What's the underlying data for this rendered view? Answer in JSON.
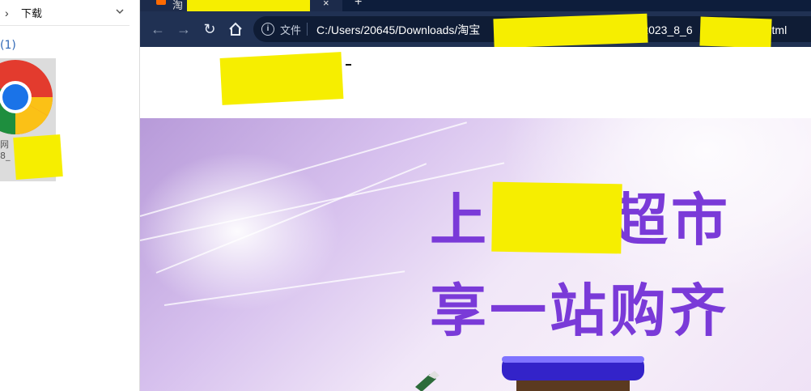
{
  "explorer": {
    "breadcrumb": "下载",
    "group_header": "(1)",
    "file": {
      "icon": "chrome-html-icon",
      "name_line1": "网",
      "name_line2": "8_"
    }
  },
  "browser": {
    "tab": {
      "title": "淘",
      "close": "×"
    },
    "new_tab": "+",
    "toolbar": {
      "scheme_label": "文件",
      "url_start": "C:/Users/20645/Downloads/淘宝",
      "url_mid": "2023_8_6",
      "url_end": "02).html"
    },
    "hero": {
      "line1_left": "上",
      "line1_right": "超市",
      "line2": "享一站购齐"
    }
  },
  "colors": {
    "tabbar": "#0d1d3b",
    "toolbar": "#203153",
    "omnibox": "#0f1c35",
    "hero_text": "#7a3ad8",
    "redaction": "#f6ee00"
  }
}
